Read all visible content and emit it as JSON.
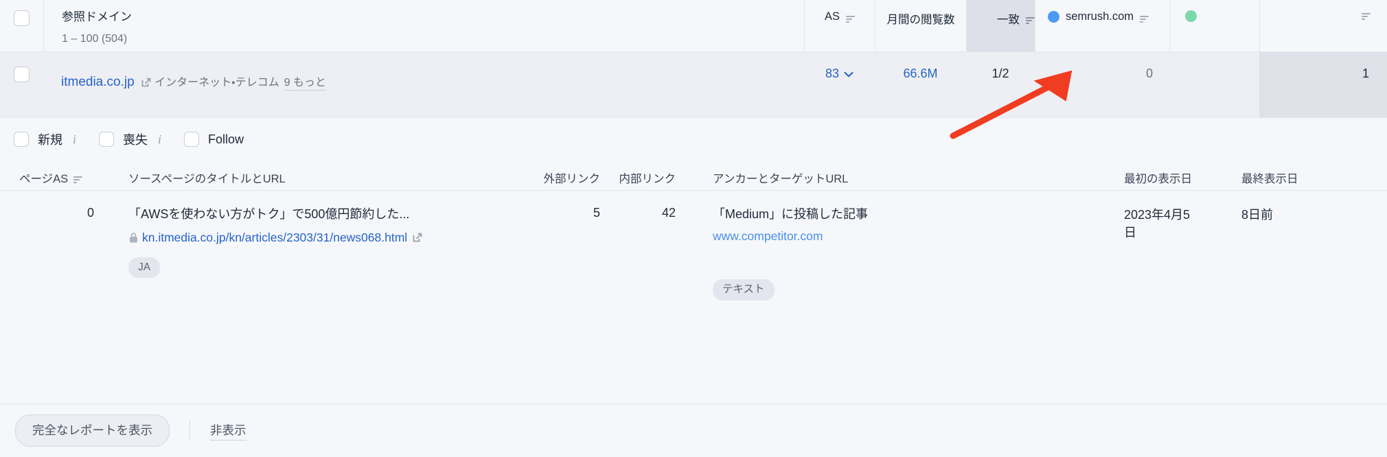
{
  "table_header": {
    "domain_column": {
      "title": "参照ドメイン",
      "range_label": "1 – 100 (504)"
    },
    "columns": [
      {
        "label": "AS",
        "icon": "sort-icon"
      },
      {
        "label": "月間の閲覧数",
        "icon": ""
      },
      {
        "label": "一致",
        "icon": "sort-icon",
        "highlighted": true
      },
      {
        "label": "semrush.com",
        "icon": "sort-icon",
        "dot_color": "#4b9bf5"
      },
      {
        "label": "",
        "icon": "",
        "dot_color": "#7ad9a8"
      },
      {
        "label": "",
        "icon": "sort-icon"
      }
    ]
  },
  "domain_row": {
    "domain": "itmedia.co.jp",
    "category": "インターネット・テレコム",
    "more_label": "9 もっと",
    "authority_score": "83",
    "monthly_visits": "66.6M",
    "match": "1/2",
    "semrush_links": "0",
    "competitor_links": "1"
  },
  "filters": [
    {
      "label": "新規",
      "info": "i",
      "checked": false
    },
    {
      "label": "喪失",
      "info": "i",
      "checked": false
    },
    {
      "label": "Follow",
      "info": "",
      "checked": false
    }
  ],
  "sub_table": {
    "headers": [
      "ページAS",
      "ソースページのタイトルとURL",
      "外部リンク",
      "内部リンク",
      "アンカーとターゲットURL",
      "最初の表示日",
      "最終表示日"
    ],
    "rows": [
      {
        "page_as": "0",
        "source_title": "「AWSを使わない方がトク」で500億円節約した...",
        "source_url": "kn.itmedia.co.jp/kn/articles/2303/31/news068.html",
        "language_badge": "JA",
        "external_links": "5",
        "internal_links": "42",
        "anchor_text": "「Medium」に投稿した記事",
        "target_url": "www.competitor.com",
        "anchor_type_badge": "テキスト",
        "first_seen": "2023年4月5日",
        "last_seen": "8日前"
      }
    ]
  },
  "footer": {
    "full_report_button": "完全なレポートを表示",
    "hide_link": "非表示"
  },
  "annotation": {
    "arrow_color": "#f03c20",
    "points_to": "competitor_links"
  },
  "colors": {
    "link_blue": "#2563c9",
    "accent_orange": "#f03c20",
    "highlight_gray": "#dedfe8",
    "page_bg": "#f5f7fa"
  }
}
